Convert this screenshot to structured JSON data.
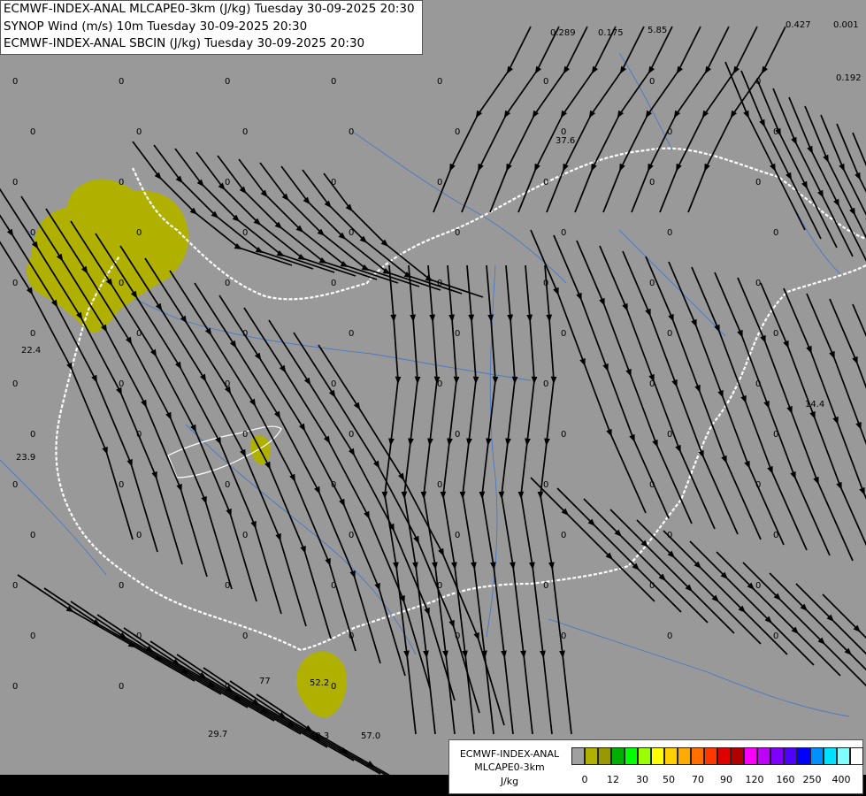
{
  "header": {
    "line1": "ECMWF-INDEX-ANAL MLCAPE0-3km (J/kg) Tuesday 30-09-2025 20:30",
    "line2": "SYNOP Wind (m/s) 10m Tuesday 30-09-2025 20:30",
    "line3": "ECMWF-INDEX-ANAL SBCIN (J/kg) Tuesday 30-09-2025 20:30"
  },
  "legend": {
    "title_line1": "ECMWF-INDEX-ANAL",
    "title_line2": "MLCAPE0-3km",
    "unit": "J/kg",
    "colors": [
      "#a0a0a0",
      "#b0b000",
      "#989800",
      "#00b000",
      "#00ff00",
      "#9cff00",
      "#ffff00",
      "#ffd000",
      "#ffaa00",
      "#ff7000",
      "#ff3800",
      "#e00000",
      "#b00000",
      "#ff00ff",
      "#c000ff",
      "#8000ff",
      "#5000ff",
      "#0000ff",
      "#0090ff",
      "#00e0ff",
      "#80ffff",
      "#ffffff"
    ],
    "ticks": [
      "0",
      "12",
      "30",
      "50",
      "70",
      "90",
      "120",
      "160",
      "250",
      "400"
    ]
  },
  "map_values": [
    {
      "t": "0.289"
    },
    {
      "t": "0.175"
    },
    {
      "t": "5.85"
    },
    {
      "t": "0.427"
    },
    {
      "t": "0.001"
    },
    {
      "t": "0.192"
    },
    {
      "t": "37.6"
    },
    {
      "t": "22.4"
    },
    {
      "t": "23.9"
    },
    {
      "t": "14.4"
    },
    {
      "t": "77"
    },
    {
      "t": "52.2"
    },
    {
      "t": "29.7"
    },
    {
      "t": "48.3"
    },
    {
      "t": "57.0"
    },
    {
      "t": "0"
    },
    {
      "t": "0"
    },
    {
      "t": "0"
    },
    {
      "t": "0"
    },
    {
      "t": "0"
    },
    {
      "t": "0"
    },
    {
      "t": "0"
    },
    {
      "t": "0"
    },
    {
      "t": "0"
    },
    {
      "t": "0"
    },
    {
      "t": "0"
    },
    {
      "t": "0"
    },
    {
      "t": "0"
    },
    {
      "t": "0"
    },
    {
      "t": "0"
    },
    {
      "t": "0"
    },
    {
      "t": "0"
    },
    {
      "t": "0"
    },
    {
      "t": "0"
    },
    {
      "t": "0"
    },
    {
      "t": "0"
    },
    {
      "t": "0"
    },
    {
      "t": "0"
    },
    {
      "t": "0"
    },
    {
      "t": "0"
    },
    {
      "t": "0"
    },
    {
      "t": "0"
    },
    {
      "t": "0"
    },
    {
      "t": "0"
    },
    {
      "t": "0"
    },
    {
      "t": "0"
    },
    {
      "t": "0"
    },
    {
      "t": "0"
    },
    {
      "t": "0"
    },
    {
      "t": "0"
    },
    {
      "t": "0"
    },
    {
      "t": "0"
    },
    {
      "t": "0"
    },
    {
      "t": "0"
    },
    {
      "t": "0"
    },
    {
      "t": "0"
    },
    {
      "t": "0"
    },
    {
      "t": "0"
    },
    {
      "t": "0"
    },
    {
      "t": "0"
    },
    {
      "t": "0"
    },
    {
      "t": "0"
    },
    {
      "t": "0"
    },
    {
      "t": "0"
    },
    {
      "t": "0"
    },
    {
      "t": "0"
    },
    {
      "t": "0"
    },
    {
      "t": "0"
    },
    {
      "t": "0"
    },
    {
      "t": "0"
    },
    {
      "t": "0"
    },
    {
      "t": "0"
    },
    {
      "t": "0"
    },
    {
      "t": "0"
    },
    {
      "t": "0"
    },
    {
      "t": "0"
    },
    {
      "t": "0"
    },
    {
      "t": "0"
    },
    {
      "t": "0"
    },
    {
      "t": "0"
    },
    {
      "t": "0"
    },
    {
      "t": "0"
    },
    {
      "t": "0"
    },
    {
      "t": "0"
    },
    {
      "t": "0"
    },
    {
      "t": "0"
    },
    {
      "t": "0"
    },
    {
      "t": "0"
    },
    {
      "t": "0"
    },
    {
      "t": "0"
    },
    {
      "t": "0"
    },
    {
      "t": "0"
    },
    {
      "t": "0"
    },
    {
      "t": "0"
    },
    {
      "t": "0"
    },
    {
      "t": "0"
    },
    {
      "t": "0"
    },
    {
      "t": "0"
    },
    {
      "t": "0"
    },
    {
      "t": "0"
    },
    {
      "t": "0"
    },
    {
      "t": "0"
    },
    {
      "t": "0"
    },
    {
      "t": "0"
    },
    {
      "t": "0"
    },
    {
      "t": "0"
    },
    {
      "t": "0"
    },
    {
      "t": "0"
    },
    {
      "t": "0"
    },
    {
      "t": "0"
    },
    {
      "t": "0"
    },
    {
      "t": "0"
    },
    {
      "t": "0"
    },
    {
      "t": "0"
    },
    {
      "t": "0"
    }
  ]
}
